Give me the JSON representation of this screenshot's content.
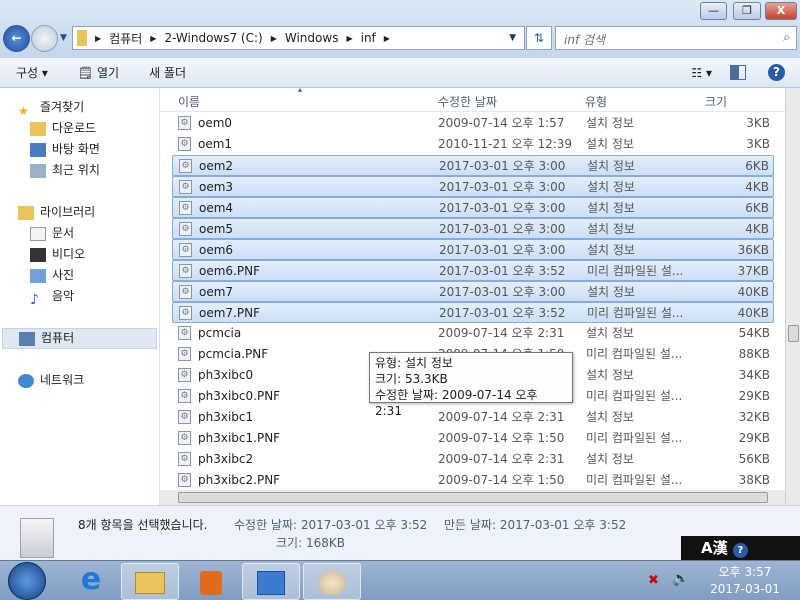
{
  "window": {
    "controls": [
      "minimize",
      "restore",
      "close"
    ]
  },
  "address": {
    "crumbs": [
      "컴퓨터",
      "2-Windows7 (C:)",
      "Windows",
      "inf"
    ],
    "search_placeholder": "inf 검색"
  },
  "toolbar": {
    "organize": "구성 ▾",
    "open": "열기",
    "new_folder": "새 폴더"
  },
  "sidebar": {
    "favorites": "즐겨찾기",
    "fav_items": [
      "다운로드",
      "바탕 화면",
      "최근 위치"
    ],
    "libraries": "라이브러리",
    "lib_items": [
      "문서",
      "비디오",
      "사진",
      "음악"
    ],
    "computer": "컴퓨터",
    "network": "네트워크"
  },
  "columns": {
    "name": "이름",
    "date": "수정한 날짜",
    "type": "유형",
    "size": "크기"
  },
  "files": [
    {
      "name": "oem0",
      "date": "2009-07-14 오후 1:57",
      "type": "설치 정보",
      "size": "3KB",
      "selected": false
    },
    {
      "name": "oem1",
      "date": "2010-11-21 오후 12:39",
      "type": "설치 정보",
      "size": "3KB",
      "selected": false
    },
    {
      "name": "oem2",
      "date": "2017-03-01 오후 3:00",
      "type": "설치 정보",
      "size": "6KB",
      "selected": true
    },
    {
      "name": "oem3",
      "date": "2017-03-01 오후 3:00",
      "type": "설치 정보",
      "size": "4KB",
      "selected": true
    },
    {
      "name": "oem4",
      "date": "2017-03-01 오후 3:00",
      "type": "설치 정보",
      "size": "6KB",
      "selected": true
    },
    {
      "name": "oem5",
      "date": "2017-03-01 오후 3:00",
      "type": "설치 정보",
      "size": "4KB",
      "selected": true
    },
    {
      "name": "oem6",
      "date": "2017-03-01 오후 3:00",
      "type": "설치 정보",
      "size": "36KB",
      "selected": true
    },
    {
      "name": "oem6.PNF",
      "date": "2017-03-01 오후 3:52",
      "type": "미리 컴파일된 설...",
      "size": "37KB",
      "selected": true
    },
    {
      "name": "oem7",
      "date": "2017-03-01 오후 3:00",
      "type": "설치 정보",
      "size": "40KB",
      "selected": true
    },
    {
      "name": "oem7.PNF",
      "date": "2017-03-01 오후 3:52",
      "type": "미리 컴파일된 설...",
      "size": "40KB",
      "selected": true
    },
    {
      "name": "pcmcia",
      "date": "2009-07-14 오후 2:31",
      "type": "설치 정보",
      "size": "54KB",
      "selected": false
    },
    {
      "name": "pcmcia.PNF",
      "date": "2009-07-14 오후 1:50",
      "type": "미리 컴파일된 설...",
      "size": "88KB",
      "selected": false
    },
    {
      "name": "ph3xibc0",
      "date": "",
      "type": "설치 정보",
      "size": "34KB",
      "selected": false
    },
    {
      "name": "ph3xibc0.PNF",
      "date": "",
      "type": "미리 컴파일된 설...",
      "size": "29KB",
      "selected": false
    },
    {
      "name": "ph3xibc1",
      "date": "2009-07-14 오후 2:31",
      "type": "설치 정보",
      "size": "32KB",
      "selected": false
    },
    {
      "name": "ph3xibc1.PNF",
      "date": "2009-07-14 오후 1:50",
      "type": "미리 컴파일된 설...",
      "size": "29KB",
      "selected": false
    },
    {
      "name": "ph3xibc2",
      "date": "2009-07-14 오후 2:31",
      "type": "설치 정보",
      "size": "56KB",
      "selected": false
    },
    {
      "name": "ph3xibc2.PNF",
      "date": "2009-07-14 오후 1:50",
      "type": "미리 컴파일된 설...",
      "size": "38KB",
      "selected": false
    }
  ],
  "tooltip": {
    "line1": "유형: 설치 정보",
    "line2": "크기: 53.3KB",
    "line3": "수정한 날짜: 2009-07-14 오후 2:31"
  },
  "status": {
    "selected": "8개 항목을 선택했습니다.",
    "modified": "수정한 날짜: 2017-03-01 오후 3:52",
    "created": "만든 날짜: 2017-03-01 오후 3:52",
    "size": "크기: 168KB"
  },
  "ime": {
    "label": "A漢"
  },
  "clock": {
    "time": "오후 3:57",
    "date": "2017-03-01"
  }
}
